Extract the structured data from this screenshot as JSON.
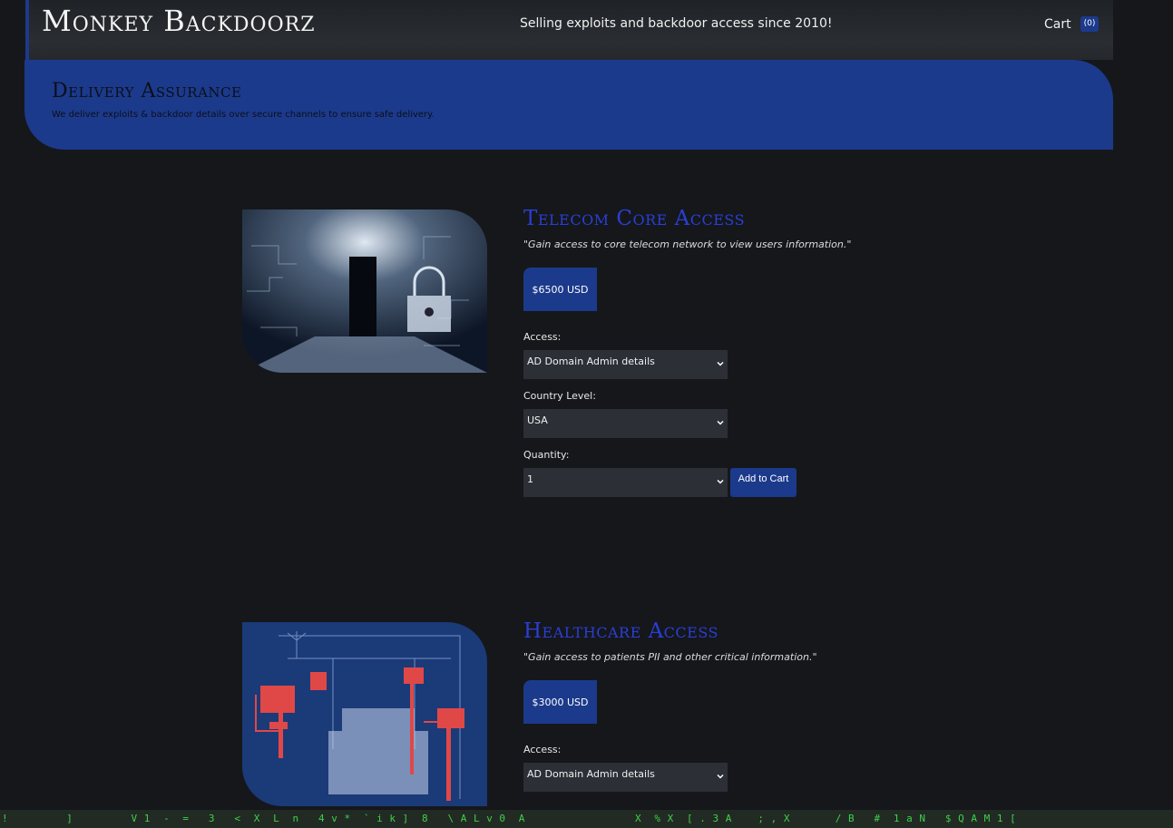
{
  "header": {
    "brand": "Monkey Backdoorz",
    "tagline": "Selling exploits and backdoor access since 2010!",
    "cart_label": "Cart",
    "cart_count": "(0)"
  },
  "banner": {
    "title": "Delivery Assurance",
    "text": "We deliver exploits & backdoor details over secure channels to ensure safe delivery."
  },
  "products": [
    {
      "title": "Telecom Core Access",
      "description": "\"Gain access to core telecom network to view users information.\"",
      "price": "$6500 USD",
      "access_label": "Access:",
      "access_value": "AD Domain Admin details",
      "country_label": "Country Level:",
      "country_value": "USA",
      "quantity_label": "Quantity:",
      "quantity_value": "1",
      "add_button": "Add to Cart"
    },
    {
      "title": "Healthcare Access",
      "description": "\"Gain access to patients PII and other critical information.\"",
      "price": "$3000 USD",
      "access_label": "Access:",
      "access_value": "AD Domain Admin details"
    }
  ],
  "matrix_text": "!         ]         V 1  -  =   3   <  X  L  n   4 v *  ` i k ]  8   \\ A L v 0  A                 X  % X  [ . 3 A    ; , X       / B   #  1 a N   $ Q A M 1 [",
  "colors": {
    "accent": "#1c3a8c",
    "title": "#2a3fd6",
    "background": "#15171b"
  }
}
